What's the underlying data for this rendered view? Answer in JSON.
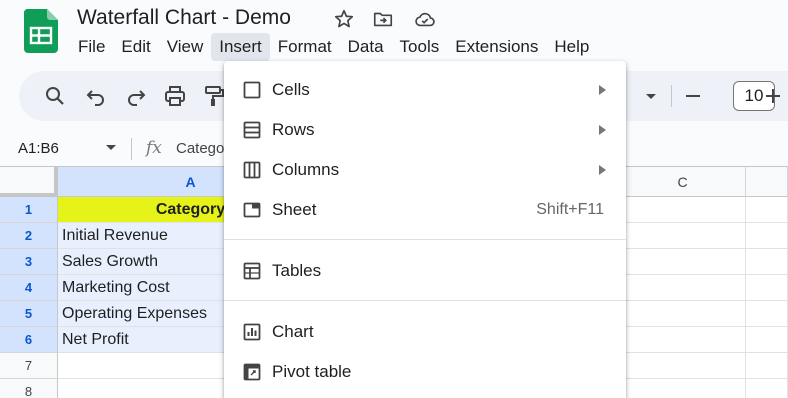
{
  "app": {
    "title": "Waterfall Chart - Demo",
    "icons": [
      "sheets-logo-icon",
      "star-icon",
      "move-to-folder-icon",
      "cloud-saved-icon"
    ]
  },
  "menu": {
    "items": [
      "File",
      "Edit",
      "View",
      "Insert",
      "Format",
      "Data",
      "Tools",
      "Extensions",
      "Help"
    ],
    "active": "Insert"
  },
  "toolbar": {
    "icons": [
      "search-icon",
      "undo-icon",
      "redo-icon",
      "print-icon",
      "paint-format-icon",
      "dropdown-caret-icon",
      "minus-icon",
      "plus-icon"
    ],
    "font_size": "10"
  },
  "formula_bar": {
    "name_box": "A1:B6",
    "fx_label": "fx",
    "content": "Catego"
  },
  "grid": {
    "columns": [
      "A",
      "C"
    ],
    "rows": [
      "1",
      "2",
      "3",
      "4",
      "5",
      "6",
      "7",
      "8"
    ],
    "cells_a": [
      "Category",
      "Initial Revenue",
      "Sales Growth",
      "Marketing Cost",
      "Operating Expenses",
      "Net Profit"
    ]
  },
  "insert_menu": {
    "items": [
      {
        "label": "Cells",
        "icon": "cells-icon",
        "submenu": true
      },
      {
        "label": "Rows",
        "icon": "rows-icon",
        "submenu": true
      },
      {
        "label": "Columns",
        "icon": "columns-icon",
        "submenu": true
      },
      {
        "label": "Sheet",
        "icon": "sheet-icon",
        "shortcut": "Shift+F11"
      },
      {
        "label": "Tables",
        "icon": "tables-icon"
      },
      {
        "label": "Chart",
        "icon": "chart-icon"
      },
      {
        "label": "Pivot table",
        "icon": "pivot-table-icon"
      }
    ]
  },
  "colors": {
    "header_fill": "#e6f319",
    "selection": "#e8f0fe",
    "sheets_green": "#0f9d58"
  }
}
